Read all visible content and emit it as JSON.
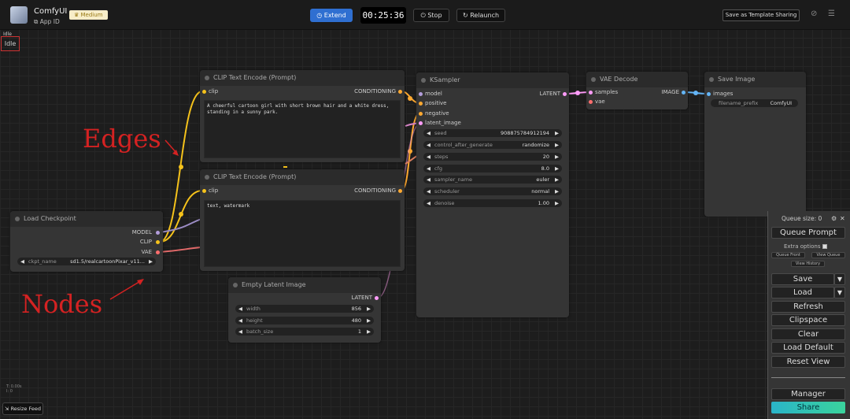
{
  "topbar": {
    "app_name": "ComfyUI",
    "app_id": "App ID",
    "tier_badge": "Medium",
    "extend_label": "Extend",
    "timer": "00:25:36",
    "stop_label": "Stop",
    "relaunch_label": "Relaunch",
    "template_label": "Save as Template Sharing"
  },
  "status": {
    "small": "Idle",
    "label": "Idle"
  },
  "annotations": {
    "edges": "Edges",
    "nodes": "Nodes"
  },
  "nodes": {
    "load_checkpoint": {
      "title": "Load Checkpoint",
      "outputs": [
        "MODEL",
        "CLIP",
        "VAE"
      ],
      "ckpt_label": "ckpt_name",
      "ckpt_value": "sd1.5/realcartoonPixar_v11..."
    },
    "clip_pos": {
      "title": "CLIP Text Encode (Prompt)",
      "input": "clip",
      "output": "CONDITIONING",
      "text": "A cheerful cartoon girl with short brown hair and a white dress, standing in a sunny park."
    },
    "clip_neg": {
      "title": "CLIP Text Encode (Prompt)",
      "input": "clip",
      "output": "CONDITIONING",
      "text": "text, watermark"
    },
    "empty_latent": {
      "title": "Empty Latent Image",
      "output": "LATENT",
      "widgets": [
        {
          "label": "width",
          "value": "856"
        },
        {
          "label": "height",
          "value": "480"
        },
        {
          "label": "batch_size",
          "value": "1"
        }
      ]
    },
    "ksampler": {
      "title": "KSampler",
      "inputs": [
        "model",
        "positive",
        "negative",
        "latent_image"
      ],
      "output": "LATENT",
      "widgets": [
        {
          "label": "seed",
          "value": "908875784912194"
        },
        {
          "label": "control_after_generate",
          "value": "randomize"
        },
        {
          "label": "steps",
          "value": "20"
        },
        {
          "label": "cfg",
          "value": "8.0"
        },
        {
          "label": "sampler_name",
          "value": "euler"
        },
        {
          "label": "scheduler",
          "value": "normal"
        },
        {
          "label": "denoise",
          "value": "1.00"
        }
      ]
    },
    "vae_decode": {
      "title": "VAE Decode",
      "inputs": [
        "samples",
        "vae"
      ],
      "output": "IMAGE"
    },
    "save_image": {
      "title": "Save Image",
      "input": "images",
      "prefix_label": "filename_prefix",
      "prefix_value": "ComfyUI"
    }
  },
  "panel": {
    "queue_size": "Queue size: 0",
    "queue_prompt": "Queue Prompt",
    "extra_options": "Extra options",
    "queue_front": "Queue Front",
    "view_queue": "View Queue",
    "view_history": "View History",
    "save": "Save",
    "load": "Load",
    "refresh": "Refresh",
    "clipspace": "Clipspace",
    "clear": "Clear",
    "load_default": "Load Default",
    "reset_view": "Reset View",
    "manager": "Manager",
    "share": "Share"
  },
  "footer": {
    "resize_feed": "Resize Feed",
    "stats_line1": "T: 0.00s",
    "stats_line2": "I: 0"
  },
  "colors": {
    "accent_blue": "#2f6fd1",
    "clip_wire": "#f5c21b",
    "model_wire": "#b39ddb",
    "vae_wire": "#ff6e6e",
    "latent_wire": "#ff9cf9",
    "conditioning_wire": "#ffa931",
    "image_wire": "#64b5f6",
    "share_gradient_start": "#2ab4c9",
    "share_gradient_end": "#3ad39c"
  }
}
